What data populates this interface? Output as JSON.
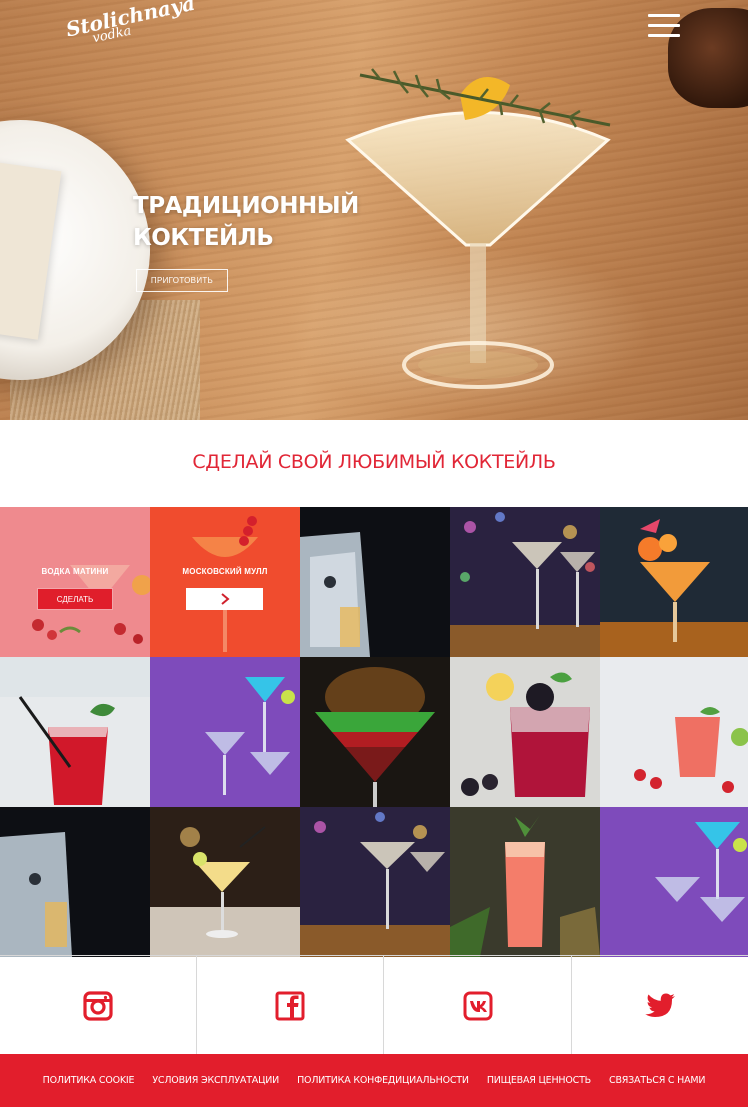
{
  "brand": {
    "line1": "Stolichnaya",
    "line2": "vodka"
  },
  "hero": {
    "title": "ТРАДИЦИОННЫЙ КОКТЕЙЛЬ",
    "button": "ПРИГОТОВИТЬ"
  },
  "section": {
    "title": "СДЕЛАЙ СВОЙ ЛЮБИМЫЙ КОКТЕЙЛЬ"
  },
  "tiles": [
    {
      "label": "ВОДКА МАТИНИ",
      "button": "СДЕЛАТЬ"
    },
    {
      "label": "МОСКОВСКИЙ МУЛЛ",
      "button_icon": "chevron-right-icon"
    }
  ],
  "social": [
    "instagram-icon",
    "facebook-icon",
    "vk-icon",
    "twitter-icon"
  ],
  "footer": {
    "links": [
      "ПОЛИТИКА COOKIE",
      "УСЛОВИЯ ЭКСПЛУАТАЦИИ",
      "ПОЛИТИКА КОНФЕДИЦИАЛЬНОСТИ",
      "ПИЩЕВАЯ ЦЕННОСТЬ",
      "СВЯЗАТЬСЯ С НАМИ"
    ]
  },
  "colors": {
    "accent": "#e21e2c",
    "text_light": "#ffffff"
  }
}
